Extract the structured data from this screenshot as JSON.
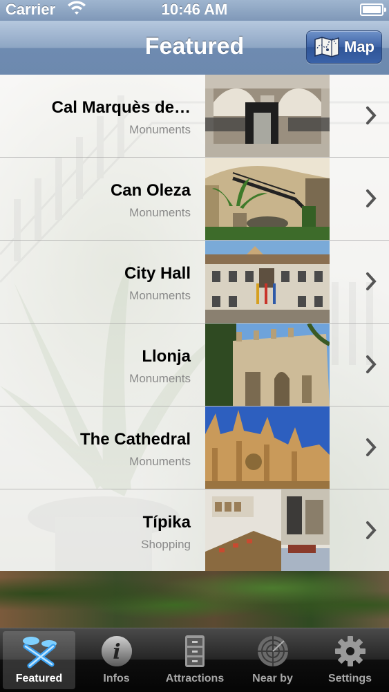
{
  "status_bar": {
    "carrier": "Carrier",
    "time": "10:46 AM"
  },
  "nav": {
    "title": "Featured",
    "map_button": "Map"
  },
  "items": [
    {
      "title": "Cal Marquès de…",
      "subtitle": "Monuments"
    },
    {
      "title": "Can Oleza",
      "subtitle": "Monuments"
    },
    {
      "title": "City Hall",
      "subtitle": "Monuments"
    },
    {
      "title": "Llonja",
      "subtitle": "Monuments"
    },
    {
      "title": "The Cathedral",
      "subtitle": "Monuments"
    },
    {
      "title": "Típika",
      "subtitle": "Shopping"
    }
  ],
  "tabs": [
    {
      "label": "Featured",
      "icon": "featured-icon",
      "active": true
    },
    {
      "label": "Infos",
      "icon": "info-icon",
      "active": false
    },
    {
      "label": "Attractions",
      "icon": "cabinet-icon",
      "active": false
    },
    {
      "label": "Near by",
      "icon": "radar-icon",
      "active": false
    },
    {
      "label": "Settings",
      "icon": "gear-icon",
      "active": false
    }
  ],
  "colors": {
    "nav_blue": "#6d89ae",
    "button_blue": "#3d63a6",
    "tab_bar": "#0e0e0e"
  }
}
